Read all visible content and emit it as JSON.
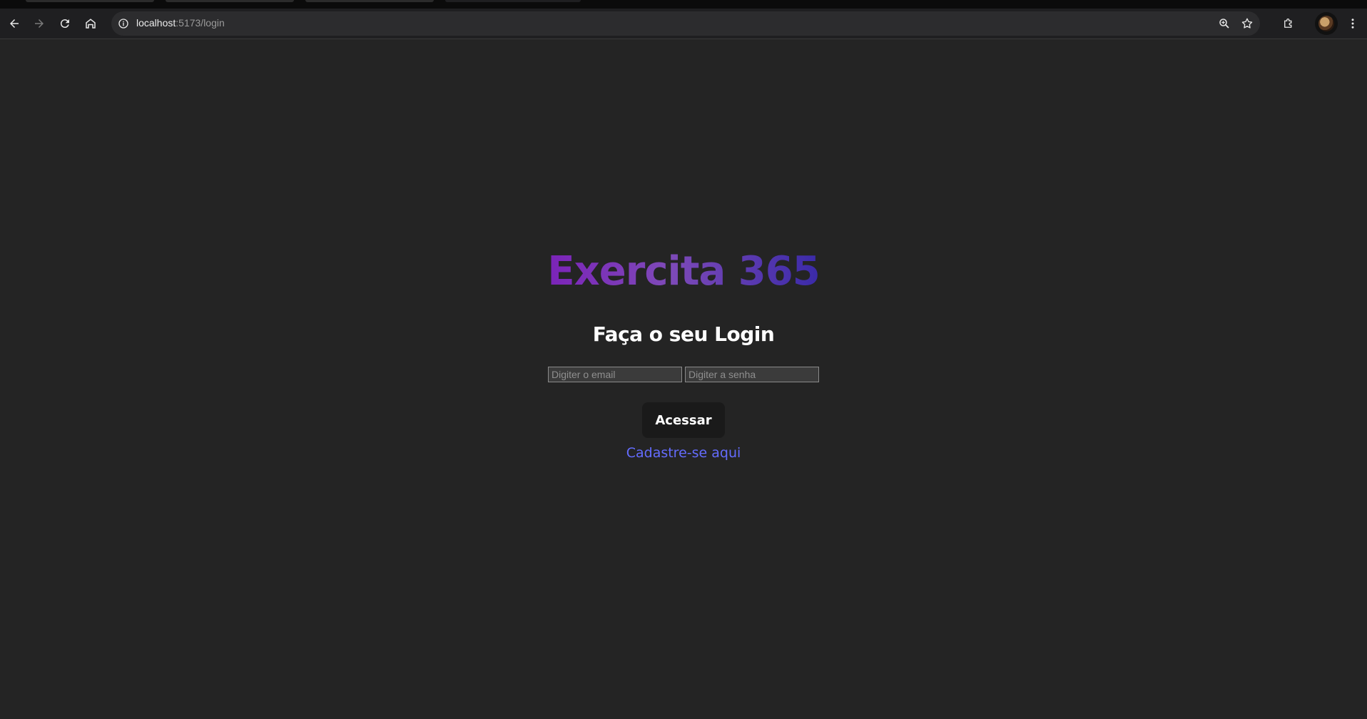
{
  "browser": {
    "url_host": "localhost",
    "url_rest": ":5173/login",
    "icons": {
      "back": "back-arrow-icon",
      "forward": "forward-arrow-icon",
      "reload": "reload-icon",
      "home": "home-icon",
      "info": "info-icon",
      "zoom": "zoom-icon",
      "bookmark": "star-icon",
      "extensions": "puzzle-icon",
      "profile": "avatar",
      "menu": "kebab-menu-icon"
    }
  },
  "login": {
    "brand": "Exercita 365",
    "heading": "Faça o seu Login",
    "email_placeholder": "Digiter o email",
    "password_placeholder": "Digiter a senha",
    "submit_label": "Acessar",
    "register_link": "Cadastre-se aqui"
  },
  "colors": {
    "background": "#242424",
    "link": "#646cff",
    "brand_gradient_start": "#7b23b8",
    "brand_gradient_end": "#3a2aa8",
    "button_bg": "#1a1a1a"
  }
}
